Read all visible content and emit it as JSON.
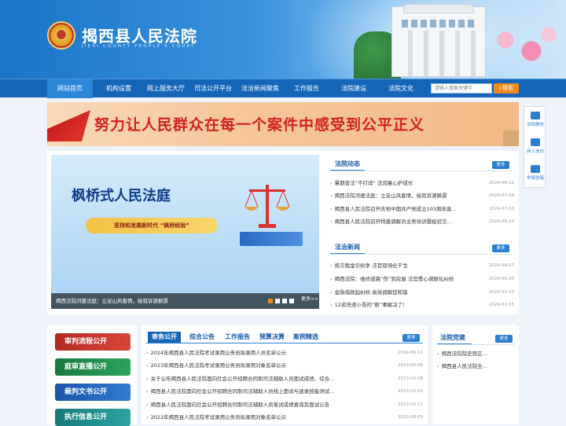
{
  "site": {
    "name": "揭西县人民法院",
    "en_name": "JIEXI COUNTY PEOPLE'S COURT"
  },
  "nav": {
    "items": [
      "网站首页",
      "机构设置",
      "网上服务大厅",
      "司法公开平台",
      "法治新闻聚焦",
      "工作报告",
      "法院建设",
      "法院文化"
    ],
    "search_placeholder": "请输入搜索关键字",
    "search_button": "搜索"
  },
  "banner": {
    "slogan": "努力让人民群众在每一个案件中感受到公平正义"
  },
  "slide": {
    "title": "枫桥式人民法庭",
    "subtitle": "坚持和发展新时代 “枫桥经验”",
    "caption": "揭西法院河婆法庭：立足山风客情，绘就诉源枫景",
    "more": "更多>>"
  },
  "court_news": {
    "title": "法院动态",
    "more": "更多",
    "items": [
      {
        "text": "暑期普法“不打烊” 法润童心护成长",
        "date": "2024-08-12"
      },
      {
        "text": "揭西法院河婆法庭：立足山风客情，绘就诉源枫景",
        "date": "2024-07-08"
      },
      {
        "text": "揭西县人民法院召开庆祝中国共产党成立103周年座...",
        "date": "2024-07-03"
      },
      {
        "text": "揭西县人民法院召开特邀调解员业务培训暨经验交...",
        "date": "2024-04-24"
      }
    ]
  },
  "law_news": {
    "title": "法治新闻",
    "more": "更多",
    "items": [
      {
        "text": "拖欠租金引纷争 法官现场化干戈",
        "date": "2024-06-07"
      },
      {
        "text": "揭西法院：维修道路“伤”到房屋 法官悉心调解化纠纷",
        "date": "2024-05-20"
      },
      {
        "text": "金融借款起纠纷 高效调解促和谐",
        "date": "2024-02-23"
      },
      {
        "text": "12名快递小哥的“薪”事解决了！",
        "date": "2024-02-05"
      }
    ]
  },
  "side_tools": [
    {
      "label": "法院微信",
      "icon": "wechat-icon"
    },
    {
      "label": "网上信访",
      "icon": "petition-icon"
    },
    {
      "label": "举报信箱",
      "icon": "mailbox-icon"
    }
  ],
  "side_buttons": [
    {
      "label": "审判流程公开",
      "color": "#c0392b"
    },
    {
      "label": "庭审直播公开",
      "color": "#1f8a4c"
    },
    {
      "label": "裁判文书公开",
      "color": "#1f62b8"
    },
    {
      "label": "执行信息公开",
      "color": "#1d8a8a"
    }
  ],
  "affairs": {
    "tabs": [
      "审务公开",
      "综合公告",
      "工作报告",
      "预算决算",
      "案例精选"
    ],
    "more": "更多",
    "items": [
      {
        "text": "2024年揭西县人民法院考试录用公务员拟录用人员名单公示",
        "date": "2024-06-12"
      },
      {
        "text": "2023年揭西县人民法院考试录用公务员拟录用对象名单公示",
        "date": "2023-06-06"
      },
      {
        "text": "关于公布揭西县人民法院面向社会公开招聘合同制司法辅助人员面试成绩、综合...",
        "date": "2023-03-28"
      },
      {
        "text": "揭西县人民法院面向社会公开招聘合同制司法辅助人员线上面试与速录技能测试...",
        "date": "2023-03-20"
      },
      {
        "text": "揭西县人民法院面向社会公开招聘合同制司法辅助人员笔试成绩查询及面试公告",
        "date": "2023-03-13"
      },
      {
        "text": "2022年揭西县人民法院考试录用公务员拟录用对象名单公示",
        "date": "2022-08-03"
      }
    ]
  },
  "party": {
    "title": "法院党建",
    "more": "更多",
    "items": [
      "揭西法院院史馆正...",
      "揭西县人民法院全..."
    ]
  }
}
